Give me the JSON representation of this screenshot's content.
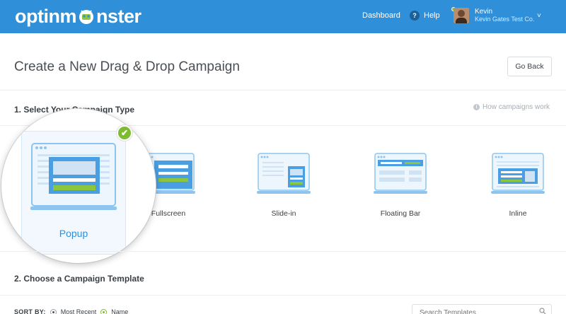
{
  "header": {
    "logo_text_left": "optinm",
    "logo_text_right": "nster",
    "nav_dashboard": "Dashboard",
    "help_icon_glyph": "?",
    "help_label": "Help",
    "user_name": "Kevin",
    "user_org": "Kevin Gates Test Co.",
    "user_chevron": "˅",
    "brand_color": "#2f8fd8"
  },
  "page": {
    "title": "Create a New Drag & Drop Campaign",
    "go_back": "Go Back"
  },
  "section1": {
    "label": "1. Select Your Campaign Type",
    "help_link": "How campaigns work",
    "info_icon_glyph": "i"
  },
  "campaign_types": {
    "selected": "Popup",
    "items": [
      {
        "label": "Popup"
      },
      {
        "label": "Fullscreen"
      },
      {
        "label": "Slide-in"
      },
      {
        "label": "Floating Bar"
      },
      {
        "label": "Inline"
      }
    ],
    "check_glyph": "✔",
    "accent_color": "#7dbb2f"
  },
  "section2": {
    "label": "2. Choose a Campaign Template"
  },
  "sort": {
    "label": "SORT BY:",
    "options": [
      {
        "label": "Most Recent"
      },
      {
        "label": "Name"
      }
    ],
    "search_placeholder": "Search Templates"
  }
}
